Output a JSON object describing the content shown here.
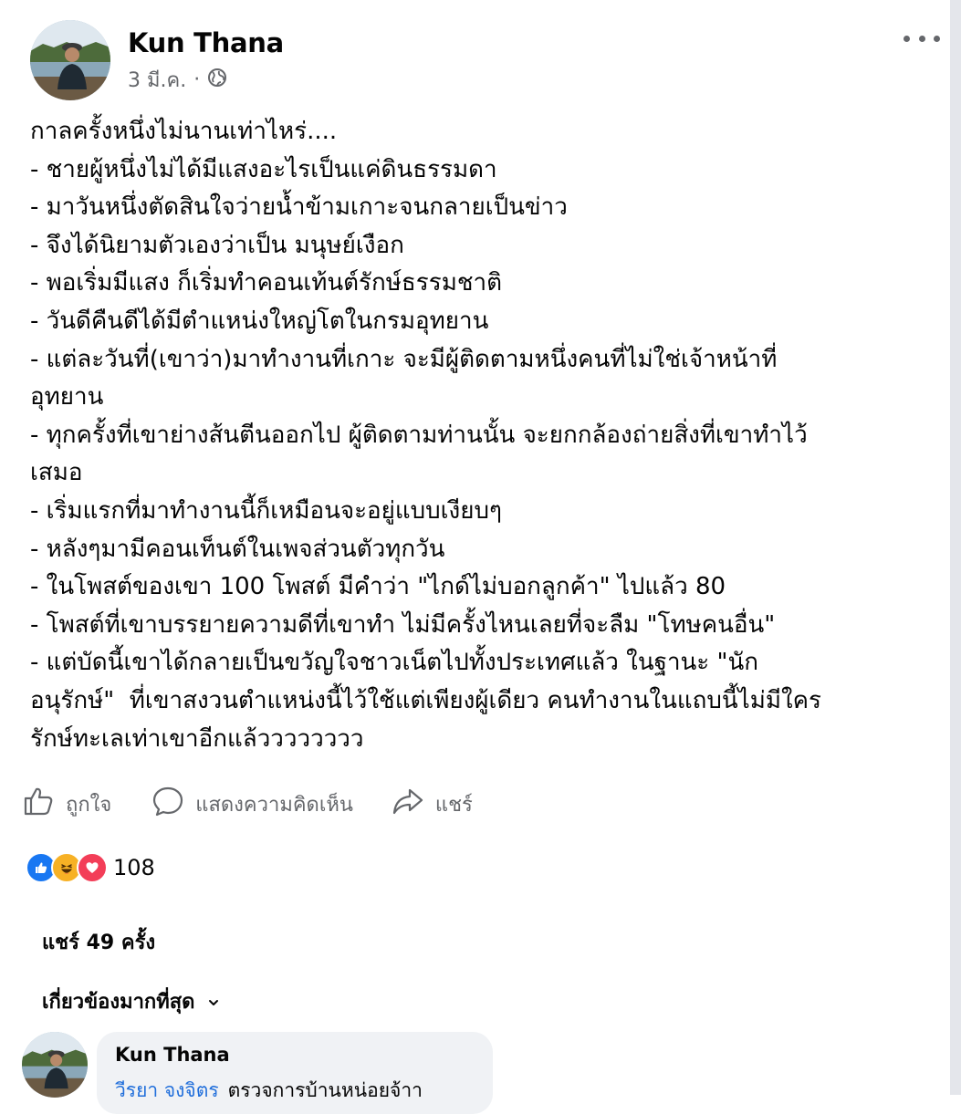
{
  "post": {
    "author": "Kun Thana",
    "date": "3 มี.ค.",
    "separator": "·",
    "privacy_icon": "globe-icon",
    "more_icon": "more-horizontal-icon",
    "text_lines": [
      "กาลครั้งหนึ่งไม่นานเท่าไหร่....",
      "- ชายผู้หนึ่งไม่ได้มีแสงอะไรเป็นแค่ดินธรรมดา",
      "- มาวันหนึ่งตัดสินใจว่ายน้ำข้ามเกาะจนกลายเป็นข่าว",
      "- จึงได้นิยามตัวเองว่าเป็น มนุษย์เงือก",
      "- พอเริ่มมีแสง ก็เริ่มทำคอนเท้นต์รักษ์ธรรมชาติ",
      "- วันดีคืนดีได้มีตำแหน่งใหญ่โตในกรมอุทยาน",
      "- แต่ละวันที่(เขาว่า)มาทำงานที่เกาะ จะมีผู้ติดตามหนึ่งคนที่ไม่ใช่เจ้าหน้าที่",
      "อุทยาน",
      "- ทุกครั้งที่เขาย่างส้นตีนออกไป ผู้ติดตามท่านนั้น จะยกกล้องถ่ายสิ่งที่เขาทำไว้",
      "เสมอ",
      "- เริ่มแรกที่มาทำงานนี้ก็เหมือนจะอยู่แบบเงียบๆ",
      "- หลังๆมามีคอนเท็นต์ในเพจส่วนตัวทุกวัน",
      "- ในโพสต์ของเขา 100 โพสต์ มีคำว่า \"ไกด์ไม่บอกลูกค้า\" ไปแล้ว 80",
      "- โพสต์ที่เขาบรรยายความดีที่เขาทำ ไม่มีครั้งไหนเลยที่จะลืม \"โทษคนอื่น\"",
      "- แต่บัดนี้เขาได้กลายเป็นขวัญใจชาวเน็ตไปทั้งประเทศแล้ว ในฐานะ \"นัก",
      "อนุรักษ์\"  ที่เขาสงวนตำแหน่งนี้ไว้ใช้แต่เพียงผู้เดียว คนทำงานในแถบนี้ไม่มีใคร",
      "รักษ์ทะเลเท่าเขาอีกแล้วววววววว"
    ]
  },
  "actions": {
    "like_label": "ถูกใจ",
    "comment_label": "แสดงความคิดเห็น",
    "share_label": "แชร์"
  },
  "reactions": {
    "count": "108",
    "icons": [
      "like-reaction-icon",
      "haha-reaction-icon",
      "love-reaction-icon"
    ],
    "colors": {
      "like": "#1877f2",
      "haha": "#f7b125",
      "love": "#f33e58"
    }
  },
  "shares_label": "แชร์ 49 ครั้ง",
  "sort_label": "เกี่ยวข้องมากที่สุด",
  "comment": {
    "author": "Kun Thana",
    "mention": "วีรยา จงจิตร",
    "text": "ตรวจการบ้านหน่อยจ้าา"
  }
}
